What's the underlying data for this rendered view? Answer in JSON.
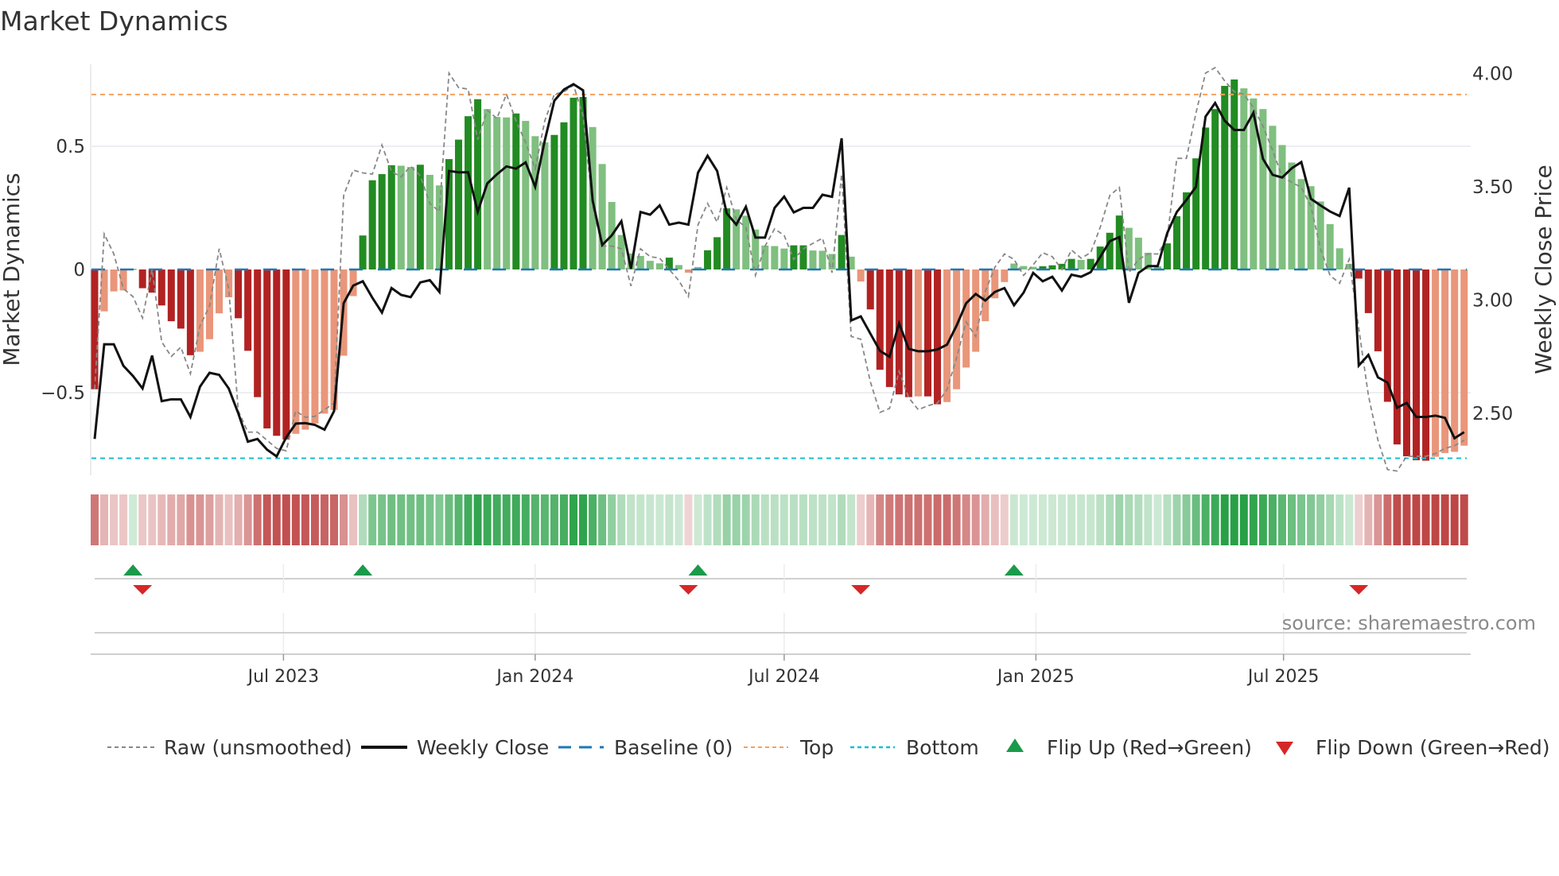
{
  "chart_data": {
    "type": "bar",
    "title": "Market Dynamics",
    "ylabel": "Market Dynamics",
    "ylabel_right": "Weekly Close Price",
    "source": "source: sharemaestro.com",
    "x_start": "2023-02-13",
    "x_step_days": 7,
    "ylim": [
      -0.84,
      0.83
    ],
    "ylim_right": [
      2.18,
      4.04
    ],
    "y_ticks": [
      {
        "v": 0.5,
        "label": "0.5"
      },
      {
        "v": 0,
        "label": "0"
      },
      {
        "v": -0.5,
        "label": "−0.5"
      }
    ],
    "y_ticks_right": [
      {
        "v": 4.0,
        "label": "4.00"
      },
      {
        "v": 3.5,
        "label": "3.50"
      },
      {
        "v": 3.0,
        "label": "3.00"
      },
      {
        "v": 2.5,
        "label": "2.50"
      }
    ],
    "x_ticks": [
      {
        "date": "2023-07-01",
        "label": "Jul 2023"
      },
      {
        "date": "2024-01-01",
        "label": "Jan 2024"
      },
      {
        "date": "2024-07-01",
        "label": "Jul 2024"
      },
      {
        "date": "2025-01-01",
        "label": "Jan 2025"
      },
      {
        "date": "2025-07-01",
        "label": "Jul 2025"
      }
    ],
    "levels": {
      "top": 0.71,
      "bottom": -0.766,
      "baseline": 0
    },
    "colors": {
      "strong_green": "#228b22",
      "weak_green": "#7fbf7f",
      "strong_red": "#b22222",
      "weak_red": "#e9967a",
      "close": "#111111",
      "raw": "#888888",
      "baseline": "#1f77b4",
      "top": "#f4a261",
      "bottom": "#17becf",
      "flip_up": "#1a9a4a",
      "flip_down": "#d62728"
    },
    "smoothed": [
      -0.486,
      -0.17,
      -0.089,
      -0.085,
      0.003,
      -0.076,
      -0.094,
      -0.146,
      -0.21,
      -0.24,
      -0.348,
      -0.334,
      -0.283,
      -0.178,
      -0.113,
      -0.198,
      -0.33,
      -0.518,
      -0.645,
      -0.675,
      -0.69,
      -0.667,
      -0.65,
      -0.625,
      -0.585,
      -0.57,
      -0.35,
      -0.108,
      0.138,
      0.362,
      0.387,
      0.423,
      0.421,
      0.416,
      0.425,
      0.384,
      0.341,
      0.448,
      0.527,
      0.622,
      0.691,
      0.651,
      0.619,
      0.617,
      0.633,
      0.603,
      0.541,
      0.516,
      0.546,
      0.597,
      0.697,
      0.7,
      0.578,
      0.428,
      0.274,
      0.14,
      0.065,
      0.055,
      0.035,
      0.025,
      0.048,
      0.018,
      -0.013,
      0.01,
      0.078,
      0.131,
      0.248,
      0.244,
      0.218,
      0.162,
      0.097,
      0.095,
      0.085,
      0.098,
      0.098,
      0.077,
      0.076,
      0.063,
      0.14,
      0.052,
      -0.049,
      -0.162,
      -0.407,
      -0.477,
      -0.507,
      -0.518,
      -0.515,
      -0.515,
      -0.547,
      -0.538,
      -0.486,
      -0.398,
      -0.334,
      -0.21,
      -0.117,
      -0.051,
      0.024,
      0.014,
      0.011,
      0.013,
      0.017,
      0.023,
      0.043,
      0.039,
      0.043,
      0.093,
      0.149,
      0.219,
      0.169,
      0.129,
      0.068,
      0.013,
      0.106,
      0.216,
      0.313,
      0.451,
      0.576,
      0.651,
      0.745,
      0.771,
      0.735,
      0.694,
      0.651,
      0.583,
      0.505,
      0.434,
      0.367,
      0.338,
      0.276,
      0.184,
      0.086,
      0.023,
      -0.037,
      -0.177,
      -0.332,
      -0.537,
      -0.71,
      -0.758,
      -0.774,
      -0.776,
      -0.76,
      -0.745,
      -0.74,
      -0.715
    ],
    "raw": [
      -0.486,
      0.144,
      0.063,
      -0.078,
      -0.11,
      -0.197,
      0.0,
      -0.294,
      -0.353,
      -0.315,
      -0.423,
      -0.229,
      -0.148,
      0.084,
      -0.078,
      -0.574,
      -0.66,
      -0.66,
      -0.693,
      -0.726,
      -0.736,
      -0.574,
      -0.6,
      -0.596,
      -0.569,
      -0.542,
      0.3,
      0.403,
      0.392,
      0.387,
      0.505,
      0.397,
      0.376,
      0.419,
      0.38,
      0.268,
      0.235,
      0.797,
      0.738,
      0.732,
      0.527,
      0.646,
      0.613,
      0.711,
      0.603,
      0.516,
      0.408,
      0.603,
      0.711,
      0.721,
      0.748,
      0.624,
      0.257,
      0.095,
      0.095,
      0.084,
      -0.067,
      0.084,
      0.052,
      0.046,
      0.0,
      -0.045,
      -0.11,
      0.181,
      0.268,
      0.192,
      0.333,
      0.203,
      0.171,
      -0.024,
      0.095,
      0.165,
      0.138,
      0.041,
      0.084,
      0.106,
      0.127,
      -0.013,
      0.387,
      -0.272,
      -0.283,
      -0.456,
      -0.58,
      -0.564,
      -0.413,
      -0.52,
      -0.569,
      -0.553,
      -0.542,
      -0.488,
      -0.359,
      -0.213,
      -0.272,
      -0.089,
      0.009,
      0.063,
      0.041,
      -0.024,
      0.019,
      0.068,
      0.052,
      0.0,
      0.079,
      0.046,
      0.068,
      0.171,
      0.3,
      0.333,
      -0.013,
      0.041,
      0.063,
      0.063,
      0.127,
      0.451,
      0.451,
      0.635,
      0.797,
      0.819,
      0.765,
      0.721,
      0.711,
      0.657,
      0.581,
      0.484,
      0.376,
      0.354,
      0.333,
      0.257,
      0.084,
      -0.024,
      -0.056,
      0.041,
      -0.24,
      -0.51,
      -0.693,
      -0.812,
      -0.818,
      -0.758,
      -0.758,
      -0.758,
      -0.747,
      -0.726,
      -0.715,
      -0.693
    ],
    "close": [
      2.387,
      2.805,
      2.805,
      2.71,
      2.665,
      2.61,
      2.755,
      2.554,
      2.562,
      2.562,
      2.484,
      2.618,
      2.679,
      2.67,
      2.61,
      2.5,
      2.375,
      2.387,
      2.34,
      2.31,
      2.394,
      2.455,
      2.457,
      2.449,
      2.428,
      2.51,
      2.986,
      3.064,
      3.083,
      3.01,
      2.945,
      3.053,
      3.023,
      3.013,
      3.078,
      3.088,
      3.036,
      3.57,
      3.564,
      3.564,
      3.39,
      3.515,
      3.555,
      3.59,
      3.58,
      3.608,
      3.5,
      3.704,
      3.88,
      3.929,
      3.953,
      3.926,
      3.44,
      3.243,
      3.286,
      3.348,
      3.138,
      3.389,
      3.377,
      3.418,
      3.333,
      3.342,
      3.333,
      3.562,
      3.637,
      3.57,
      3.383,
      3.333,
      3.412,
      3.276,
      3.276,
      3.407,
      3.457,
      3.387,
      3.407,
      3.407,
      3.465,
      3.456,
      3.714,
      2.91,
      2.928,
      2.852,
      2.776,
      2.75,
      2.897,
      2.785,
      2.774,
      2.774,
      2.782,
      2.803,
      2.887,
      2.986,
      3.027,
      2.998,
      3.036,
      3.053,
      2.977,
      3.033,
      3.12,
      3.083,
      3.103,
      3.042,
      3.112,
      3.103,
      3.123,
      3.19,
      3.26,
      3.278,
      2.988,
      3.12,
      3.15,
      3.15,
      3.296,
      3.389,
      3.442,
      3.5,
      3.81,
      3.87,
      3.792,
      3.751,
      3.751,
      3.827,
      3.623,
      3.553,
      3.541,
      3.582,
      3.609,
      3.447,
      3.418,
      3.391,
      3.371,
      3.496,
      2.711,
      2.758,
      2.659,
      2.636,
      2.525,
      2.546,
      2.484,
      2.484,
      2.49,
      2.48,
      2.39,
      2.417
    ],
    "flip_up_weeks": [
      5,
      29,
      64,
      97
    ],
    "flip_down_weeks": [
      6,
      63,
      81,
      133
    ],
    "legend": {
      "raw": "Raw (unsmoothed)",
      "close": "Weekly Close",
      "baseline": "Baseline (0)",
      "top": "Top",
      "bottom": "Bottom",
      "flip_up": "Flip Up (Red→Green)",
      "flip_down": "Flip Down (Green→Red)"
    }
  }
}
